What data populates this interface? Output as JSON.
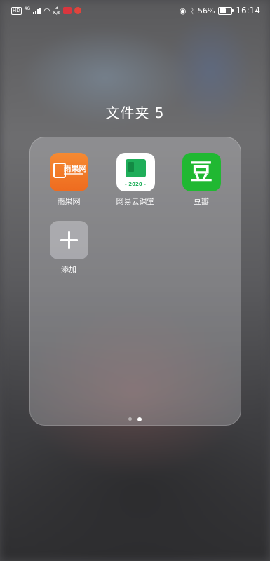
{
  "status_bar": {
    "hd_label": "HD",
    "network_label": "4G",
    "speed_value": "3",
    "speed_unit": "K/s",
    "battery_percent": "56%",
    "battery_level": 0.56,
    "time": "16:14"
  },
  "folder": {
    "title": "文件夹 5",
    "apps": [
      {
        "label": "雨果网",
        "icon": "yuguo-app-icon",
        "icon_text": "雨果网"
      },
      {
        "label": "网易云课堂",
        "icon": "netease-cloud-class-icon",
        "icon_text": "- 2020 -"
      },
      {
        "label": "豆瓣",
        "icon": "douban-icon",
        "icon_text": "豆"
      },
      {
        "label": "添加",
        "icon": "add-icon"
      }
    ]
  },
  "pager": {
    "page_count": 2,
    "current_page": 2
  }
}
